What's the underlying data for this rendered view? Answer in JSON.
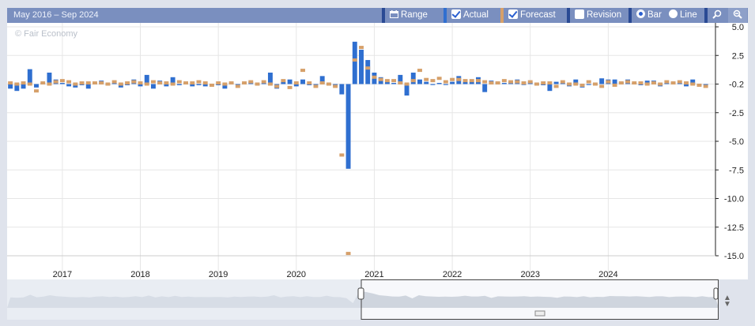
{
  "toolbar": {
    "range_title": "May 2016 – Sep 2024",
    "range_button": "Range",
    "actual_label": "Actual",
    "forecast_label": "Forecast",
    "revision_label": "Revision",
    "bar_label": "Bar",
    "line_label": "Line",
    "actual_checked": true,
    "forecast_checked": true,
    "revision_checked": false,
    "mode": "bar",
    "icons": [
      "calendar-icon",
      "zoom-in-icon",
      "zoom-out-icon"
    ]
  },
  "watermark": "© Fair Economy",
  "colors": {
    "actual": "#2f6fd0",
    "forecast": "#d6a06a",
    "toolbar": "#7a8fbf",
    "grid": "#e6e6e6"
  },
  "chart_data": {
    "type": "bar",
    "title": "",
    "xlabel": "",
    "ylabel": "",
    "ylim": [
      -15.5,
      5.0
    ],
    "yticks": [
      5.0,
      2.5,
      0,
      -2.5,
      -5.0,
      -7.5,
      -10.0,
      -12.5,
      -15.0
    ],
    "ytick_labels": [
      "5.0",
      "2.5",
      "-0.2",
      "-2.5",
      "-5.0",
      "-7.5",
      "-10.0",
      "-12.5",
      "-15.0"
    ],
    "current_value_label": "-0.2",
    "x_labels": [
      "2017",
      "2018",
      "2019",
      "2020",
      "2021",
      "2022",
      "2023",
      "2024"
    ],
    "x_start": "2016-05",
    "x_end": "2024-09",
    "grid": true,
    "series": [
      {
        "name": "Actual",
        "values": [
          -0.4,
          -0.6,
          -0.4,
          1.3,
          -0.3,
          0.1,
          1.0,
          0.4,
          0.1,
          -0.2,
          -0.3,
          -0.1,
          -0.4,
          0.1,
          0.3,
          -0.1,
          0.1,
          -0.3,
          -0.1,
          0.4,
          -0.2,
          0.8,
          -0.4,
          0.3,
          -0.2,
          0.6,
          -0.1,
          0.1,
          -0.2,
          -0.1,
          -0.2,
          -0.1,
          -0.1,
          -0.4,
          0.1,
          -0.1,
          0.1,
          0.2,
          -0.1,
          0.1,
          1.0,
          -0.4,
          0.2,
          0.4,
          -0.2,
          0.4,
          -0.1,
          -0.1,
          0.7,
          -0.1,
          -0.2,
          -0.9,
          -7.4,
          3.7,
          3.0,
          2.1,
          1.0,
          0.6,
          0.2,
          0.1,
          0.8,
          -1.0,
          1.0,
          0.4,
          0.2,
          0.0,
          0.1,
          0.0,
          0.2,
          0.7,
          0.2,
          0.2,
          0.6,
          -0.7,
          0.3,
          0.2,
          0.1,
          0.2,
          0.4,
          0.0,
          0.2,
          0.0,
          -0.1,
          -0.6,
          0.2,
          0.1,
          -0.2,
          0.4,
          -0.3,
          0.0,
          -0.1,
          0.5,
          0.4,
          0.4,
          0.2,
          0.4,
          0.1,
          -0.1,
          0.3,
          0.3,
          -0.2,
          0.1,
          0.2,
          0.1,
          -0.2,
          0.4,
          -0.2,
          -0.1
        ],
        "color": "#2f6fd0"
      },
      {
        "name": "Forecast",
        "values": [
          0.1,
          0.0,
          0.1,
          0.0,
          -0.6,
          0.1,
          0.0,
          0.2,
          0.3,
          0.2,
          0.0,
          0.1,
          0.1,
          0.1,
          0.1,
          0.0,
          0.2,
          0.0,
          0.1,
          0.2,
          0.1,
          0.0,
          0.2,
          0.1,
          0.1,
          0.0,
          0.2,
          0.1,
          0.1,
          0.2,
          0.1,
          -0.1,
          0.1,
          0.0,
          0.1,
          -0.2,
          0.1,
          0.2,
          0.0,
          0.2,
          0.0,
          -0.2,
          0.3,
          -0.3,
          0.1,
          1.2,
          0.1,
          -0.2,
          0.1,
          0.0,
          -0.2,
          -6.2,
          -14.8,
          2.1,
          3.2,
          1.4,
          0.6,
          0.4,
          0.3,
          0.3,
          0.1,
          0.0,
          0.3,
          1.2,
          0.4,
          0.3,
          0.5,
          0.2,
          0.4,
          0.4,
          0.3,
          0.3,
          0.3,
          0.2,
          0.1,
          0.1,
          0.3,
          0.2,
          0.2,
          0.1,
          0.2,
          0.0,
          0.1,
          0.1,
          -0.2,
          0.2,
          0.0,
          0.0,
          -0.1,
          0.2,
          0.0,
          -0.2,
          0.2,
          -0.1,
          0.1,
          0.2,
          0.1,
          0.1,
          0.0,
          0.1,
          0.0,
          0.2,
          0.1,
          0.2,
          0.1,
          0.0,
          -0.1,
          -0.2
        ],
        "color": "#d6a06a"
      }
    ]
  }
}
